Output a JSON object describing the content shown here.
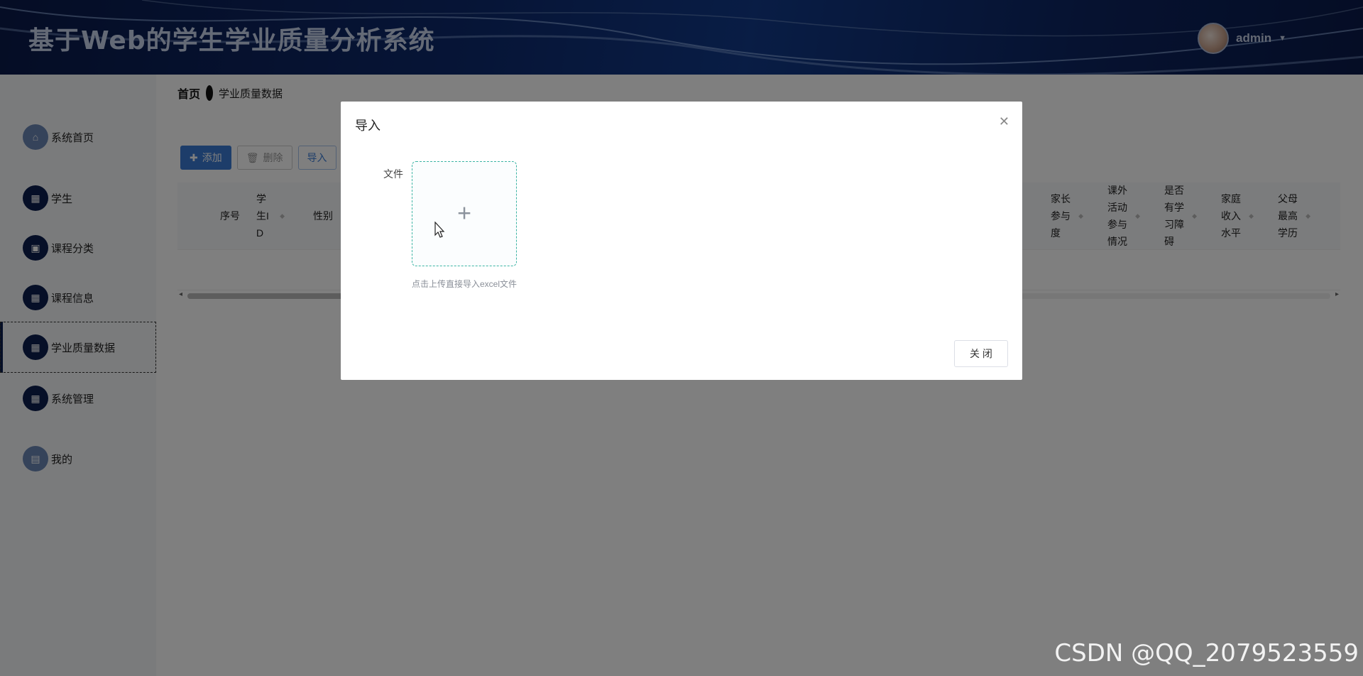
{
  "header": {
    "title": "基于Web的学生学业质量分析系统",
    "username": "admin",
    "caret": "▼"
  },
  "sidebar": {
    "items": [
      {
        "label": "系统首页",
        "icon": "home-icon"
      },
      {
        "label": "学生",
        "icon": "grid-icon"
      },
      {
        "label": "课程分类",
        "icon": "briefcase-icon"
      },
      {
        "label": "课程信息",
        "icon": "grid-icon"
      },
      {
        "label": "学业质量数据",
        "icon": "grid-icon",
        "active": true
      },
      {
        "label": "系统管理",
        "icon": "grid-icon"
      },
      {
        "label": "我的",
        "icon": "profile-icon"
      }
    ]
  },
  "breadcrumb": {
    "home": "首页",
    "current": "学业质量数据"
  },
  "toolbar": {
    "add": "添加",
    "delete": "删除",
    "import": "导入"
  },
  "table": {
    "columns_left": [
      "序号",
      "学生I D",
      "性别"
    ],
    "columns_right": [
      "家长参与度",
      "课外活动参与情况",
      "是否有学习障碍",
      "家庭收入水平",
      "父母最高学历"
    ]
  },
  "dialog": {
    "title": "导入",
    "file_label": "文件",
    "upload_tip": "点击上传直接导入excel文件",
    "close_button": "关 闭"
  },
  "watermark": "CSDN @QQ_2079523559"
}
